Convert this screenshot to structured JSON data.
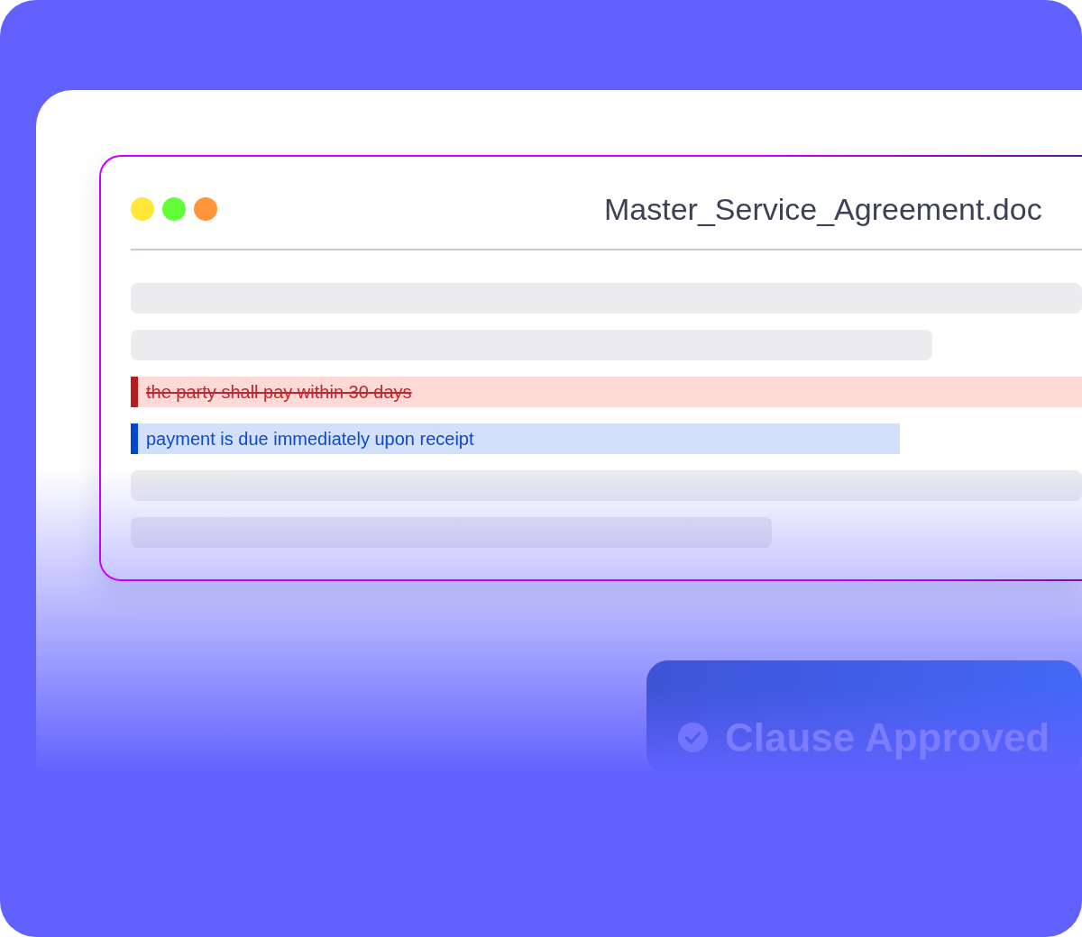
{
  "window": {
    "dots": [
      {
        "color": "#ffe838"
      },
      {
        "color": "#62ff38"
      },
      {
        "color": "#ff9438"
      }
    ],
    "title": "Master_Service_Agreement.doc"
  },
  "document": {
    "lines": [
      {
        "kind": "placeholder"
      },
      {
        "kind": "placeholder"
      },
      {
        "kind": "deleted",
        "text": "the party shall pay within 30 days"
      },
      {
        "kind": "inserted",
        "text": "payment is due immediately upon receipt"
      },
      {
        "kind": "placeholder"
      },
      {
        "kind": "placeholder"
      }
    ]
  },
  "toast": {
    "text": "Clause Approved"
  }
}
